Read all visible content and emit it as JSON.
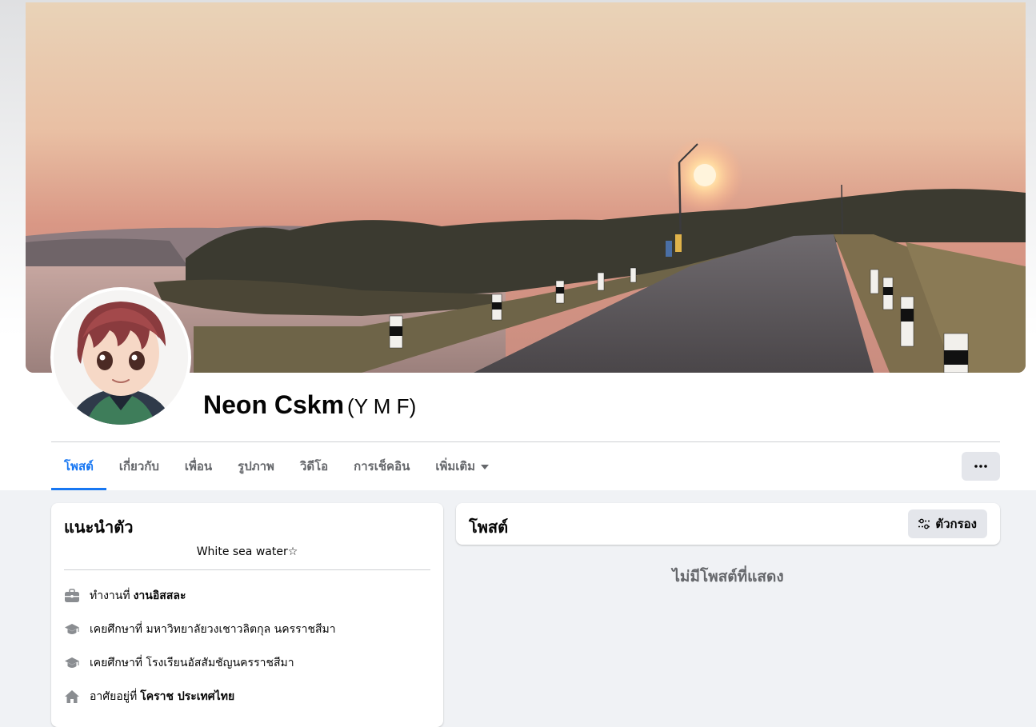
{
  "profile": {
    "name": "Neon Cskm",
    "alternate_name": "(Y M F)"
  },
  "tabs": [
    {
      "label": "โพสต์",
      "active": true
    },
    {
      "label": "เกี่ยวกับ"
    },
    {
      "label": "เพื่อน"
    },
    {
      "label": "รูปภาพ"
    },
    {
      "label": "วิดีโอ"
    },
    {
      "label": "การเช็คอิน"
    },
    {
      "label": "เพิ่มเติม",
      "has_dropdown": true
    }
  ],
  "more_button": {
    "icon": "more-horizontal-icon"
  },
  "intro": {
    "title": "แนะนำตัว",
    "bio": "White sea water☆",
    "items": [
      {
        "icon": "briefcase-icon",
        "prefix": "ทำงานที่",
        "value": "งานอิสสละ",
        "value_bold": true
      },
      {
        "icon": "graduation-cap-icon",
        "prefix": "เคยศึกษาที่",
        "value": "มหาวิทยาลัยวงเชาวลิตกุล นครราชสีมา",
        "value_bold": false
      },
      {
        "icon": "graduation-cap-icon",
        "prefix": "เคยศึกษาที่",
        "value": "โรงเรียนอัสสัมชัญนครราชสีมา",
        "value_bold": false
      },
      {
        "icon": "home-icon",
        "prefix": "อาศัยอยู่ที่",
        "value": "โคราช ประเทศไทย",
        "value_bold": true
      }
    ]
  },
  "posts": {
    "title": "โพสต์",
    "filter_label": "ตัวกรอง",
    "empty_message": "ไม่มีโพสต์ที่แสดง"
  },
  "colors": {
    "accent": "#1877f2",
    "page_background": "#f0f2f5",
    "secondary_text": "#65676b",
    "button_gray": "#e4e6eb"
  }
}
